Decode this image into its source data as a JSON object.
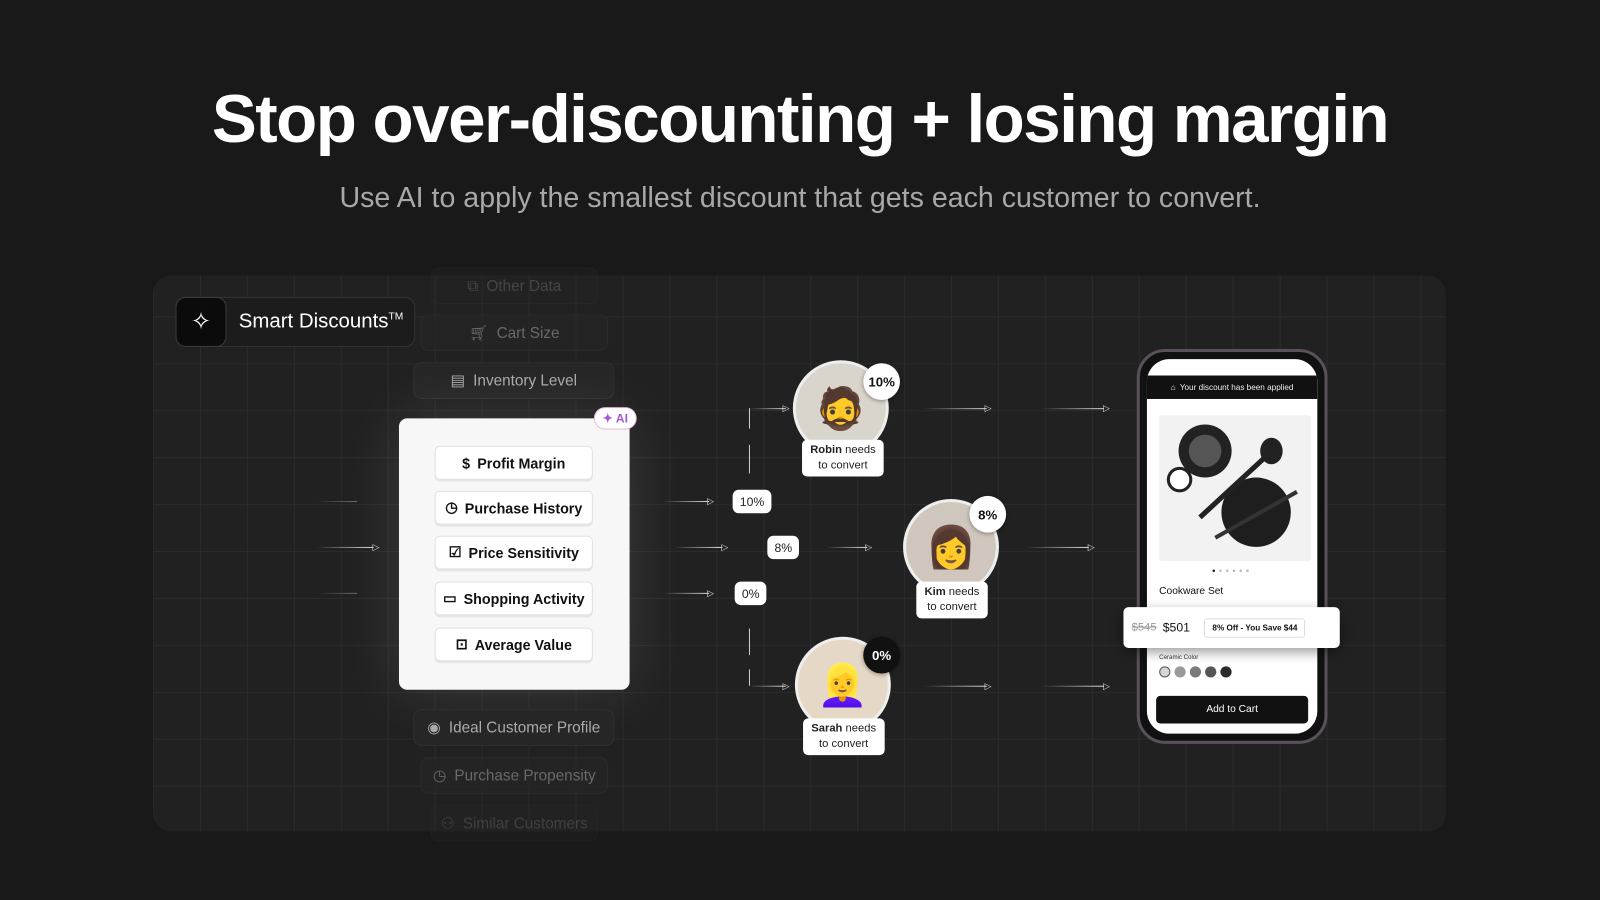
{
  "hero": {
    "title": "Stop over-discounting + losing margin",
    "subtitle": "Use AI to apply the smallest discount that gets each customer to convert."
  },
  "brand": {
    "name": "Smart Discounts",
    "tm": "TM",
    "icon": "sparkle-icon"
  },
  "ghost_inputs_top": [
    {
      "label": "Other Data",
      "icon": "data-icon"
    },
    {
      "label": "Cart Size",
      "icon": "cart-icon"
    },
    {
      "label": "Inventory Level",
      "icon": "archive-icon"
    }
  ],
  "ghost_inputs_bottom": [
    {
      "label": "Ideal Customer Profile",
      "icon": "user-circle-icon"
    },
    {
      "label": "Purchase Propensity",
      "icon": "clock-icon"
    },
    {
      "label": "Similar Customers",
      "icon": "users-icon"
    }
  ],
  "ai_badge": "✦ AI",
  "signals": [
    {
      "label": "Profit Margin",
      "icon": "dollar-icon"
    },
    {
      "label": "Purchase History",
      "icon": "clock-icon"
    },
    {
      "label": "Price Sensitivity",
      "icon": "receipt-icon"
    },
    {
      "label": "Shopping Activity",
      "icon": "card-icon"
    },
    {
      "label": "Average Value",
      "icon": "cash-icon"
    }
  ],
  "discount_tags": [
    "10%",
    "8%",
    "0%"
  ],
  "customers": [
    {
      "name": "Robin",
      "rest": " needs",
      "line2": "to convert",
      "discount": "10%"
    },
    {
      "name": "Kim",
      "rest": " needs",
      "line2": "to convert",
      "discount": "8%"
    },
    {
      "name": "Sarah",
      "rest": " needs",
      "line2": "to convert",
      "discount": "0%"
    }
  ],
  "phone": {
    "banner": "Your discount has been applied",
    "product": "Cookware Set",
    "old_price": "$545",
    "new_price": "$501",
    "savings": "8% Off - You Save $44",
    "color_label": "Ceramic Color",
    "swatches": [
      "#d6d6d6",
      "#9a9a9a",
      "#7a7a7a",
      "#555555",
      "#2a2a2a"
    ],
    "cta": "Add to Cart"
  }
}
